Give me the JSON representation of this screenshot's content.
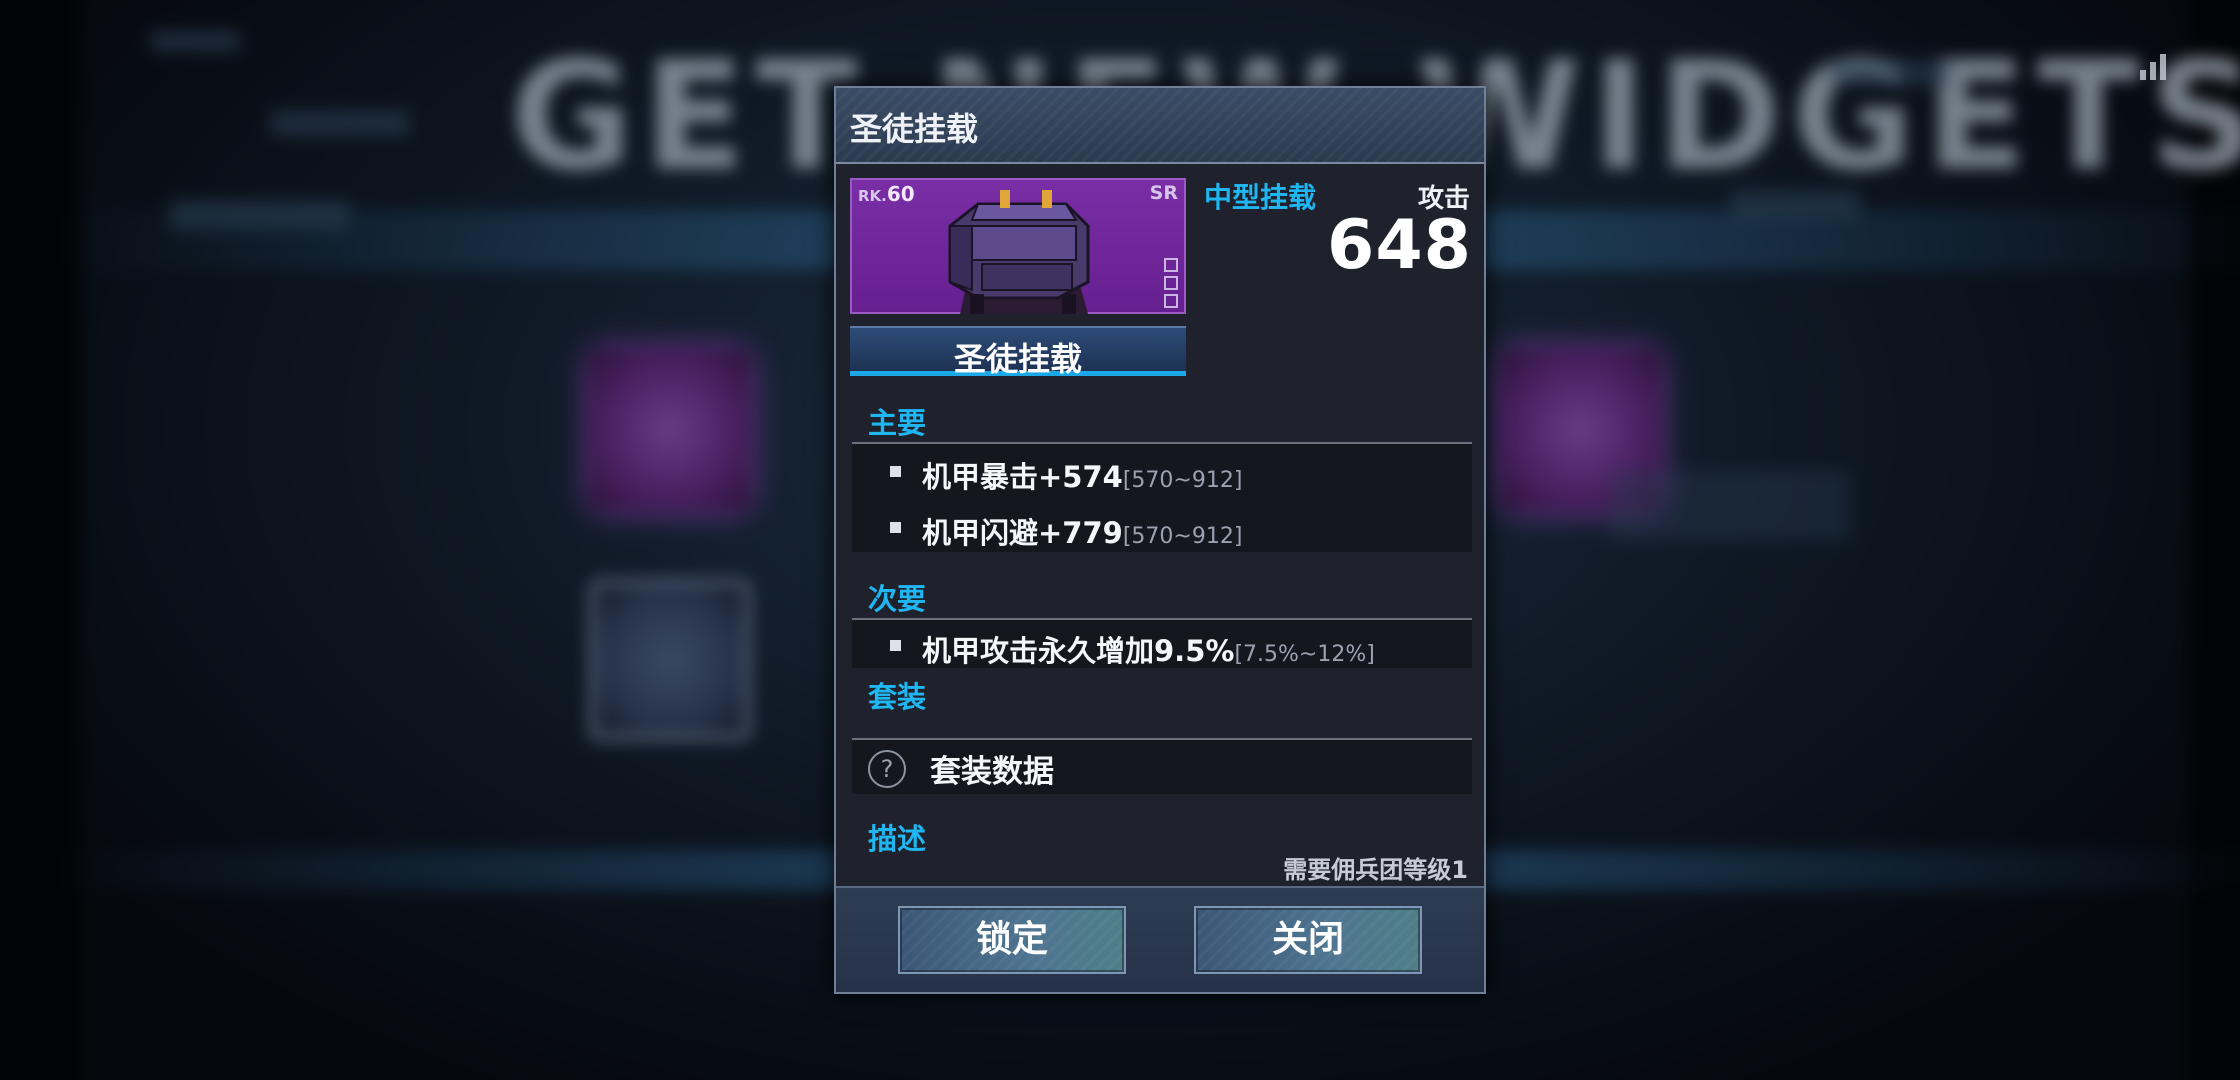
{
  "background": {
    "headline": "GET NEW WIDGETS",
    "glyph": "▪"
  },
  "dialog": {
    "title": "圣徒挂载",
    "item": {
      "rank_prefix": "RK.",
      "rank_value": "60",
      "grade": "SR",
      "name": "圣徒挂载",
      "type": "中型挂载",
      "attack_label": "攻击",
      "attack_value": "648",
      "image": "purple-mech-mount"
    },
    "sections": {
      "main_title": "主要",
      "main_stats": [
        {
          "text": "机甲暴击+574",
          "range": "[570~912]"
        },
        {
          "text": "机甲闪避+779",
          "range": "[570~912]"
        }
      ],
      "secondary_title": "次要",
      "secondary_stats": [
        {
          "text": "机甲攻击永久增加9.5%",
          "range": "[7.5%~12%]"
        }
      ],
      "set_title": "套装",
      "set_text": "套装数据",
      "set_icon": "?",
      "desc_title": "描述",
      "requirement": "需要佣兵团等级1"
    },
    "buttons": {
      "lock": "锁定",
      "close": "关闭"
    }
  },
  "colors": {
    "accent": "#1fb6f2",
    "card_purple": "#7a2ea6",
    "panel": "#1f222c"
  }
}
